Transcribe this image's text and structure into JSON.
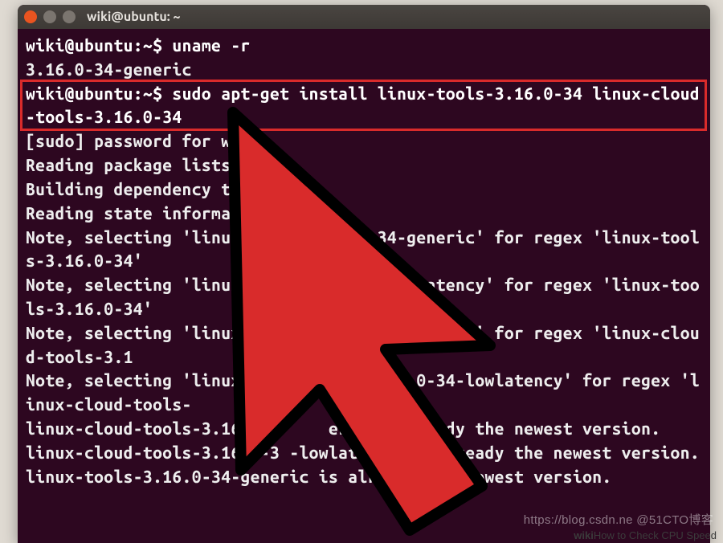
{
  "window": {
    "title": "wiki@ubuntu: ~"
  },
  "prompt": "wiki@ubuntu:~$",
  "lines": {
    "l1_cmd": "uname -r",
    "l2": "3.16.0-34-generic",
    "l3_cmd": "sudo apt-get install linux-tools-3.16.0-34 linux-cloud-tools-3.16.0-34",
    "l4": "[sudo] password for wiki:",
    "l5": "Reading package lists... ",
    "l6": "Building dependency tree",
    "l7": "Reading state information",
    "l8": "Note, selecting 'linux-to           34-generic' for regex 'linux-tools-3.16.0-34'",
    "l9": "Note, selecting 'linux-to              wlatency' for regex 'linux-tools-3.16.0-34'",
    "l10": "Note, selecting 'linux-cl               eneric' for regex 'linux-cloud-tools-3.1",
    "l11": "Note, selecting 'linux-cl             5.0-34-lowlatency' for regex 'linux-cloud-tools-",
    "l12": "linux-cloud-tools-3.16.0-      eri     lready the newest version.",
    "l13": "linux-cloud-tools-3.16.0-3 -lowlaten      already the newest version.",
    "l14": "linux-tools-3.16.0-34-generic is alrea    he newest version."
  },
  "watermark": "https://blog.csdn.ne @51CTO博客",
  "caption_prefix": "wiki",
  "caption_text": "How to Check CPU Speed"
}
